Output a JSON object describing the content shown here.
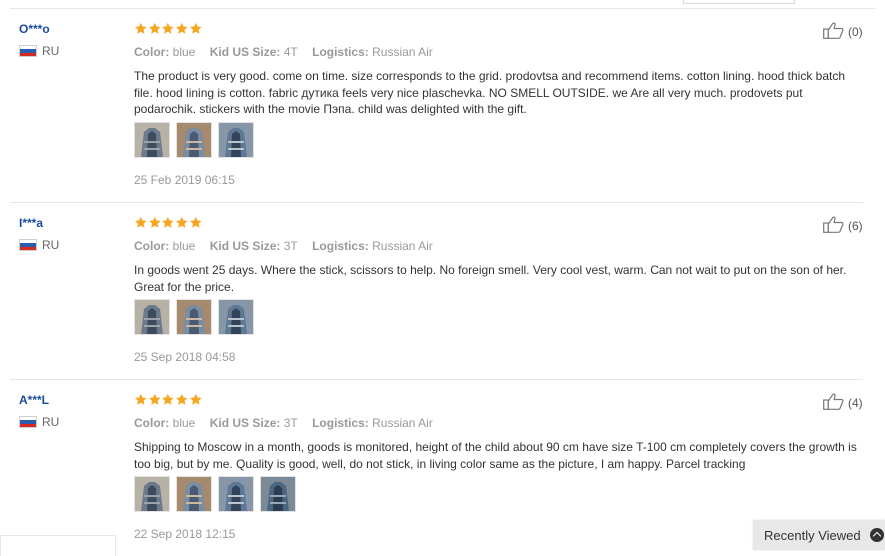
{
  "reviews": [
    {
      "user": "O***o",
      "country": "RU",
      "rating": 5,
      "color_label": "Color:",
      "color_value": "blue",
      "size_label": "Kid US Size:",
      "size_value": "4T",
      "logistics_label": "Logistics:",
      "logistics_value": "Russian Air",
      "text": "The product is very good. come on time. size corresponds to the grid. prodovtsa and recommend items. cotton lining. hood thick batch file. hood lining is cotton. fabric дутика feels very nice plaschevka. NO SMELL OUTSIDE. we Are all very much. prodovets put podarochik. stickers with the movie Пэпа. child was delighted with the gift.",
      "photo_count": 3,
      "date": "25 Feb 2019 06:15",
      "likes": "(0)"
    },
    {
      "user": "I***a",
      "country": "RU",
      "rating": 5,
      "color_label": "Color:",
      "color_value": "blue",
      "size_label": "Kid US Size:",
      "size_value": "3T",
      "logistics_label": "Logistics:",
      "logistics_value": "Russian Air",
      "text": "In goods went 25 days. Where the stick, scissors to help. No foreign smell. Very cool vest, warm. Can not wait to put on the son of her. Great for the price.",
      "photo_count": 3,
      "date": "25 Sep 2018 04:58",
      "likes": "(6)"
    },
    {
      "user": "A***L",
      "country": "RU",
      "rating": 5,
      "color_label": "Color:",
      "color_value": "blue",
      "size_label": "Kid US Size:",
      "size_value": "3T",
      "logistics_label": "Logistics:",
      "logistics_value": "Russian Air",
      "text": "Shipping to Moscow in a month, goods is monitored, height of the child about 90 cm have size T-100 cm completely covers the growth is too big, but by me. Quality is good, well, do not stick, in living color same as the picture, I am happy. Parcel tracking",
      "photo_count": 4,
      "date": "22 Sep 2018 12:15",
      "likes": "(4)"
    }
  ],
  "recently_viewed": "Recently Viewed",
  "colors": {
    "star": "#f5a623",
    "username": "#1a4b9c",
    "muted": "#999999"
  },
  "icons": {
    "rating": "star-icon",
    "like": "thumbs-up-icon",
    "country": "russia-flag-icon",
    "expand": "chevron-up-icon"
  }
}
